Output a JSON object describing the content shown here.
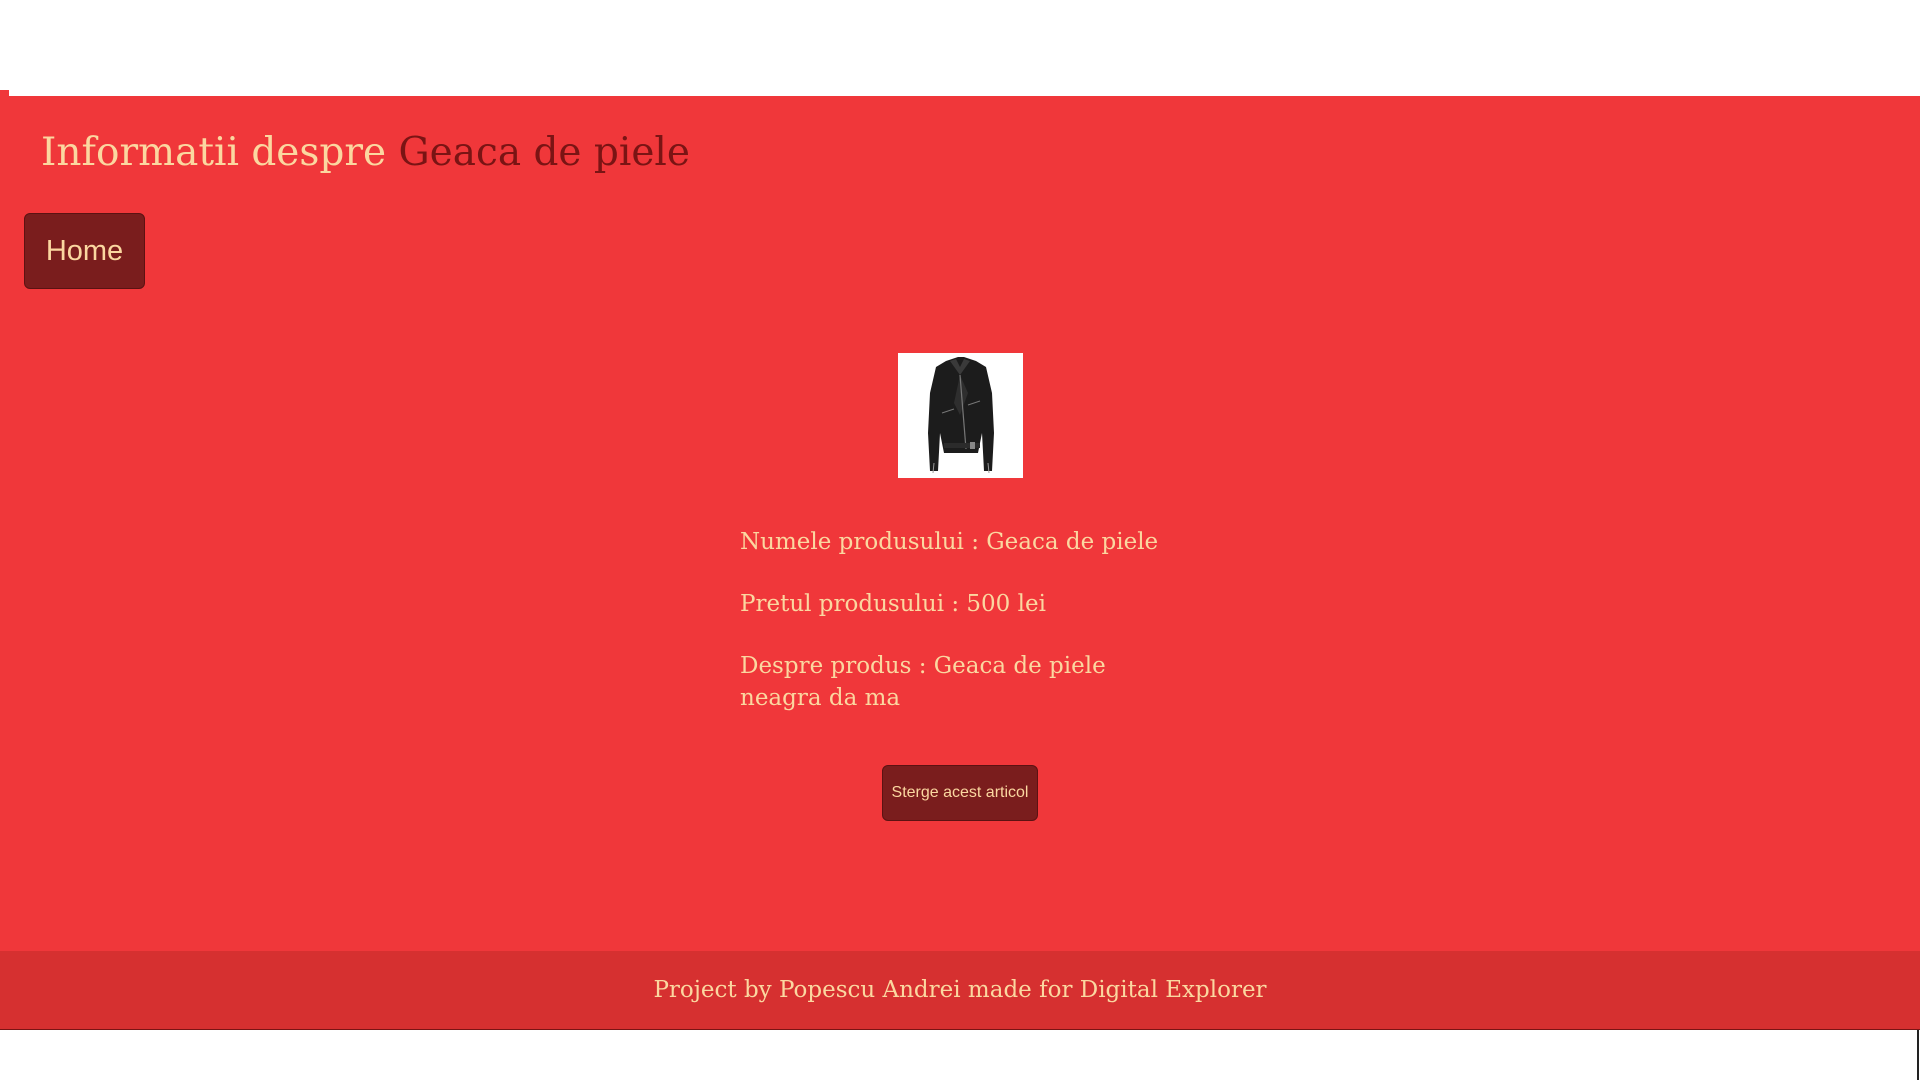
{
  "header": {
    "title_prefix": "Informatii despre",
    "product_name": "Geaca de piele"
  },
  "nav": {
    "home_label": "Home"
  },
  "product": {
    "image_icon": "leather-jacket-image",
    "name_line": "Numele produsului : Geaca de piele",
    "price_line": "Pretul produsului : 500 lei",
    "description_line": "Despre produs : Geaca de piele neagra da ma"
  },
  "actions": {
    "delete_label": "Sterge acest articol"
  },
  "footer": {
    "text": "Project by Popescu Andrei made for Digital Explorer"
  },
  "colors": {
    "background": "#f0373a",
    "button": "#7a1d1d",
    "text": "#fbd7a0",
    "accent_text": "#7a1414",
    "footer": "#d63030"
  }
}
